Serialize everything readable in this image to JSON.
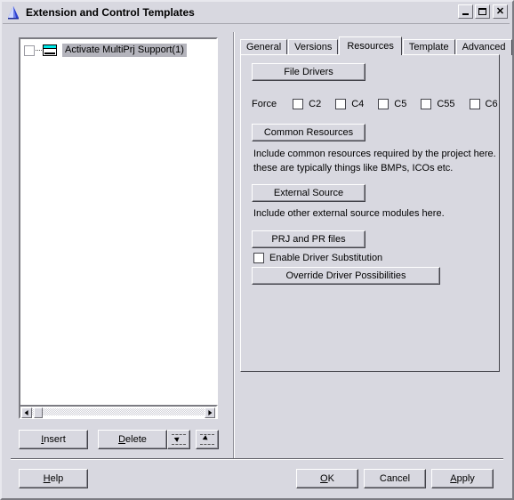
{
  "window": {
    "title": "Extension and Control Templates",
    "icon": "pyramid-icon",
    "controls": {
      "minimize": "minimize-icon",
      "maximize": "maximize-icon",
      "close": "close-icon",
      "close_glyph": "✕"
    }
  },
  "tree": {
    "items": [
      {
        "label": "Activate MultiPrj Support(1)",
        "checked": false,
        "selected": true,
        "icon": "window-node-icon"
      }
    ],
    "scrollbar": {
      "left_arrow": "scroll-left-icon",
      "right_arrow": "scroll-right-icon"
    }
  },
  "tree_toolbar": {
    "insert_label": "Insert",
    "insert_accel": "I",
    "delete_label": "Delete",
    "delete_accel": "D",
    "move_up_icon": "move-up-icon",
    "move_down_icon": "move-down-icon"
  },
  "tabs": {
    "items": [
      {
        "label": "General",
        "selected": false
      },
      {
        "label": "Versions",
        "selected": false
      },
      {
        "label": "Resources",
        "selected": true
      },
      {
        "label": "Template",
        "selected": false
      },
      {
        "label": "Advanced",
        "selected": false
      }
    ]
  },
  "resources": {
    "file_drivers_label": "File Drivers",
    "force_label": "Force",
    "force_options": [
      {
        "label": "C2",
        "checked": false
      },
      {
        "label": "C4",
        "checked": false
      },
      {
        "label": "C5",
        "checked": false
      },
      {
        "label": "C55",
        "checked": false
      },
      {
        "label": "C6",
        "checked": false
      }
    ],
    "common_resources_label": "Common Resources",
    "common_desc_line1": "Include common resources required by the project here.",
    "common_desc_line2": "these are typically things like BMPs, ICOs etc.",
    "external_source_label": "External Source",
    "external_desc": "Include other external source modules here.",
    "prj_files_label": "PRJ and PR files",
    "enable_driver_substitution_label": "Enable Driver Substitution",
    "enable_driver_substitution_checked": false,
    "override_driver_label": "Override Driver Possibilities"
  },
  "footer": {
    "help_label": "Help",
    "help_accel": "H",
    "ok_label": "OK",
    "ok_accel": "O",
    "cancel_label": "Cancel",
    "apply_label": "Apply",
    "apply_accel": "A"
  },
  "colors": {
    "face": "#d8d8e0",
    "selection": "#b4b4bc",
    "icon_accent": "#00e8e8",
    "title_icon": "#2b3fd0"
  }
}
